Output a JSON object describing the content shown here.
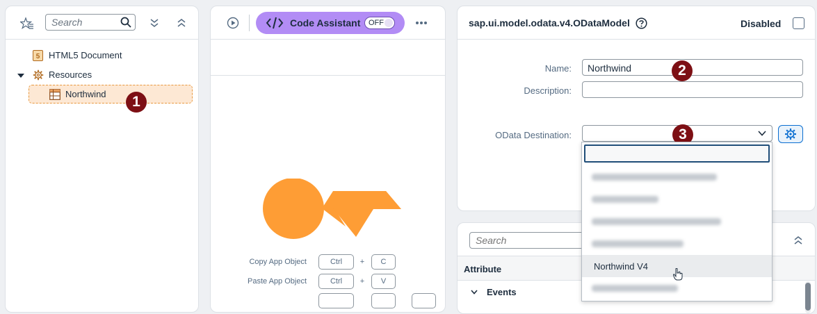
{
  "explorer": {
    "search_placeholder": "Search",
    "tree": [
      {
        "label": "HTML5 Document"
      },
      {
        "label": "Resources"
      },
      {
        "label": "Northwind"
      }
    ],
    "badge1": "1"
  },
  "toolbar": {
    "code_assistant_label": "Code Assistant",
    "toggle_label": "OFF"
  },
  "shortcuts": [
    {
      "label": "Copy App Object",
      "key1": "Ctrl",
      "plus": "+",
      "key2": "C"
    },
    {
      "label": "Paste App Object",
      "key1": "Ctrl",
      "plus": "+",
      "key2": "V"
    }
  ],
  "properties": {
    "title": "sap.ui.model.odata.v4.ODataModel",
    "disabled_label": "Disabled",
    "name_label": "Name:",
    "name_value": "Northwind",
    "description_label": "Description:",
    "description_value": "",
    "destination_label": "OData Destination:",
    "badge2": "2",
    "badge3": "3"
  },
  "dropdown": {
    "search_value": "",
    "highlighted_item": "Northwind V4"
  },
  "attributes_panel": {
    "search_placeholder": "Search",
    "column_header": "Attribute",
    "events_label": "Events"
  }
}
